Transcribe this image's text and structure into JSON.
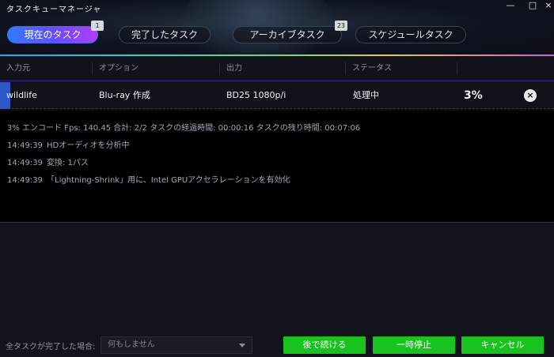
{
  "window": {
    "title": "タスクキューマネージャ",
    "minimize_label": "—",
    "maximize_label": "□",
    "close_label": "×"
  },
  "tabs": [
    {
      "label": "現在のタスク",
      "badge": "1",
      "active": true
    },
    {
      "label": "完了したタスク",
      "badge": "",
      "active": false
    },
    {
      "label": "アーカイブタスク",
      "badge": "23",
      "active": false
    },
    {
      "label": "スケジュールタスク",
      "badge": "",
      "active": false
    }
  ],
  "table": {
    "headers": [
      "入力元",
      "オプション",
      "出力",
      "ステータス"
    ],
    "rows": [
      {
        "input": "wildlife",
        "option": "Blu-ray 作成",
        "output": "BD25 1080p/i",
        "status": "処理中",
        "progress": "3%",
        "remove_icon": "×"
      }
    ]
  },
  "log": {
    "summary": "3% エンコード Fps: 140.45  合計: 2/2  タスクの経過時間: 00:00:16  タスクの残り時間: 00:07:06",
    "entries": [
      {
        "time": "14:49:39",
        "text": "HDオーディオを分析中"
      },
      {
        "time": "14:49:39",
        "text": "変換: 1パス"
      },
      {
        "time": "14:49:39",
        "text": "「Lightning-Shrink」用に、Intel GPUアクセラレーションを有効化"
      }
    ]
  },
  "footer": {
    "after_all_label": "全タスクが完了した場合:",
    "after_all_value": "何もしません",
    "buttons": {
      "resume_later": "後で続ける",
      "pause": "一時停止",
      "cancel": "キャンセル"
    }
  },
  "colors": {
    "accent_green": "#18c21f",
    "tab_active_start": "#2e7bff",
    "tab_active_end": "#b43cff",
    "row_accent": "#2d56c8"
  }
}
